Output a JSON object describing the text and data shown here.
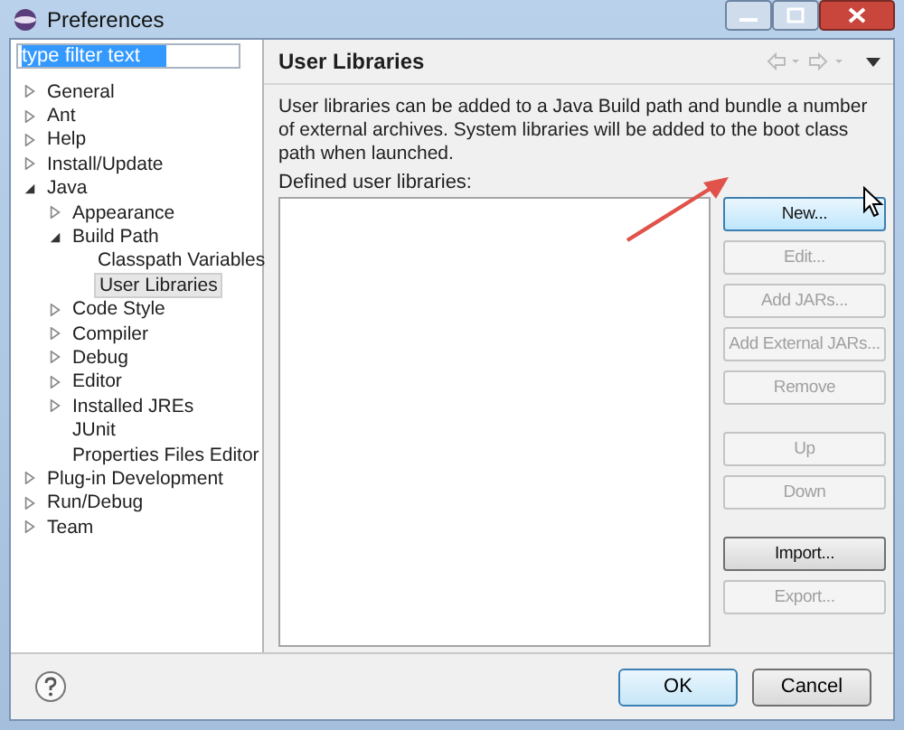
{
  "window": {
    "title": "Preferences"
  },
  "filter": {
    "value": "type filter text"
  },
  "tree": [
    {
      "label": "General",
      "kind": "folder",
      "expanded": false,
      "selected": false
    },
    {
      "label": "Ant",
      "kind": "folder",
      "expanded": false,
      "selected": false
    },
    {
      "label": "Help",
      "kind": "folder",
      "expanded": false,
      "selected": false
    },
    {
      "label": "Install/Update",
      "kind": "folder",
      "expanded": false,
      "selected": false
    },
    {
      "label": "Java",
      "kind": "folder",
      "expanded": true,
      "selected": false,
      "children": [
        {
          "label": "Appearance",
          "kind": "folder",
          "expanded": false,
          "selected": false
        },
        {
          "label": "Build Path",
          "kind": "folder",
          "expanded": true,
          "selected": false,
          "children": [
            {
              "label": "Classpath Variables",
              "kind": "leaf",
              "selected": false
            },
            {
              "label": "User Libraries",
              "kind": "leaf",
              "selected": true
            }
          ]
        },
        {
          "label": "Code Style",
          "kind": "folder",
          "expanded": false,
          "selected": false
        },
        {
          "label": "Compiler",
          "kind": "folder",
          "expanded": false,
          "selected": false
        },
        {
          "label": "Debug",
          "kind": "folder",
          "expanded": false,
          "selected": false
        },
        {
          "label": "Editor",
          "kind": "folder",
          "expanded": false,
          "selected": false
        },
        {
          "label": "Installed JREs",
          "kind": "folder",
          "expanded": false,
          "selected": false
        },
        {
          "label": "JUnit",
          "kind": "leaf",
          "selected": false
        },
        {
          "label": "Properties Files Editor",
          "kind": "leaf",
          "selected": false
        }
      ]
    },
    {
      "label": "Plug-in Development",
      "kind": "folder",
      "expanded": false,
      "selected": false
    },
    {
      "label": "Run/Debug",
      "kind": "folder",
      "expanded": false,
      "selected": false
    },
    {
      "label": "Team",
      "kind": "folder",
      "expanded": false,
      "selected": false
    }
  ],
  "page": {
    "title": "User Libraries",
    "description": "User libraries can be added to a Java Build path and bundle a number of external archives. System libraries will be added to the boot class path when launched.",
    "list_label": "Defined user libraries:"
  },
  "buttons": [
    {
      "label": "New...",
      "disabled": false,
      "hovered": true,
      "separator_before": false
    },
    {
      "label": "Edit...",
      "disabled": true,
      "hovered": false,
      "separator_before": false
    },
    {
      "label": "Add JARs...",
      "disabled": true,
      "hovered": false,
      "separator_before": false
    },
    {
      "label": "Add External JARs...",
      "disabled": true,
      "hovered": false,
      "separator_before": false
    },
    {
      "label": "Remove",
      "disabled": true,
      "hovered": false,
      "separator_before": false
    },
    {
      "label": "Up",
      "disabled": true,
      "hovered": false,
      "separator_before": true
    },
    {
      "label": "Down",
      "disabled": true,
      "hovered": false,
      "separator_before": false
    },
    {
      "label": "Import...",
      "disabled": false,
      "hovered": false,
      "separator_before": true
    },
    {
      "label": "Export...",
      "disabled": true,
      "hovered": false,
      "separator_before": false
    }
  ],
  "footer": {
    "ok": "OK",
    "cancel": "Cancel"
  }
}
